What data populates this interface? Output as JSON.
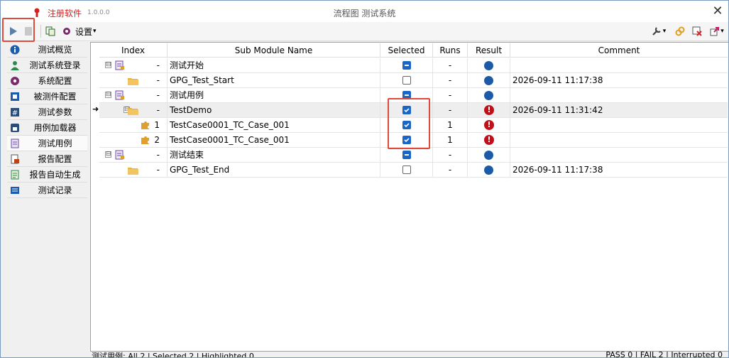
{
  "titlebar": {
    "app_label": "注册软件",
    "version": "1.0.0.0",
    "window_title": "流程图 测试系统",
    "close": "✕"
  },
  "toolbar": {
    "settings_label": "设置",
    "settings_arrow": "▾",
    "run_icon": "play-icon",
    "stop_icon": "stop-icon",
    "colors": {
      "run": "#5b7fa6",
      "stop": "#c8c8c8"
    }
  },
  "sidebar": {
    "items": [
      {
        "label": "测试概览",
        "icon": "info-icon",
        "color": "#1a5cae"
      },
      {
        "label": "测试系统登录",
        "icon": "user-icon",
        "color": "#2a8a4a"
      },
      {
        "label": "系统配置",
        "icon": "gear-icon",
        "color": "#7a2a6a"
      },
      {
        "label": "被测件配置",
        "icon": "chip-icon",
        "color": "#1a5cae"
      },
      {
        "label": "测试参数",
        "icon": "hash-icon",
        "color": "#2b4d7a"
      },
      {
        "label": "用例加载器",
        "icon": "loader-icon",
        "color": "#2b4d7a"
      },
      {
        "label": "测试用例",
        "icon": "testcase-icon",
        "color": "#6a4aa0"
      },
      {
        "label": "报告配置",
        "icon": "report-config-icon",
        "color": "#c0401a"
      },
      {
        "label": "报告自动生成",
        "icon": "report-gen-icon",
        "color": "#2a8a4a"
      },
      {
        "label": "测试记录",
        "icon": "record-icon",
        "color": "#1a5cae"
      }
    ]
  },
  "grid": {
    "columns": [
      "Index",
      "Sub Module Name",
      "Selected",
      "Runs",
      "Result",
      "Comment"
    ],
    "rows": [
      {
        "level": 0,
        "expander": "⊟",
        "icon": "module-icon",
        "index": "-",
        "name": "测试开始",
        "selected": "indeterminate",
        "runs": "-",
        "result": "dot",
        "comment": ""
      },
      {
        "level": 1,
        "expander": "",
        "icon": "folder-icon",
        "index": "-",
        "name": "GPG_Test_Start",
        "selected": "unchecked",
        "runs": "-",
        "result": "dot",
        "comment": "2026-09-11 11:17:38"
      },
      {
        "level": 0,
        "expander": "⊟",
        "icon": "module-icon",
        "index": "-",
        "name": "测试用例",
        "selected": "indeterminate",
        "runs": "-",
        "result": "dot",
        "comment": ""
      },
      {
        "level": 1,
        "expander": "⊟",
        "icon": "folder-icon",
        "index": "-",
        "name": "TestDemo",
        "selected": "checked",
        "runs": "-",
        "result": "error",
        "comment": "2026-09-11 11:31:42",
        "highlight": true
      },
      {
        "level": 2,
        "expander": "",
        "icon": "puzzle-icon",
        "index": "1",
        "name": "TestCase0001_TC_Case_001",
        "selected": "checked",
        "runs": "1",
        "result": "error",
        "comment": ""
      },
      {
        "level": 2,
        "expander": "",
        "icon": "puzzle-icon",
        "index": "2",
        "name": "TestCase0001_TC_Case_001",
        "selected": "checked",
        "runs": "1",
        "result": "error",
        "comment": ""
      },
      {
        "level": 0,
        "expander": "⊟",
        "icon": "module-icon",
        "index": "-",
        "name": "测试结束",
        "selected": "indeterminate",
        "runs": "-",
        "result": "dot",
        "comment": ""
      },
      {
        "level": 1,
        "expander": "",
        "icon": "folder-icon",
        "index": "-",
        "name": "GPG_Test_End",
        "selected": "unchecked",
        "runs": "-",
        "result": "dot",
        "comment": "2026-09-11 11:17:38"
      }
    ],
    "current_row_marker": "➜"
  },
  "status": {
    "left": "测试用例: All 2 | Selected 2 | Highlighted 0",
    "right": "PASS 0 | FAIL 2 | Interrupted 0"
  },
  "colors": {
    "selected_blue": "#1a66c8",
    "result_dot": "#1c5aa8",
    "result_error": "#c0101a",
    "highlight_box": "#e04a3a"
  }
}
